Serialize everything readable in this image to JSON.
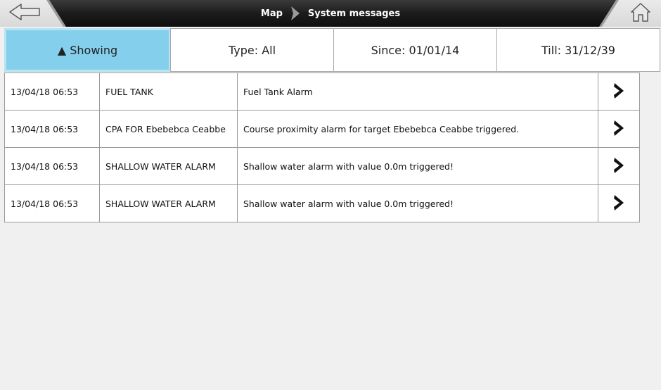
{
  "header": {
    "back_icon": "back-arrow-icon",
    "home_icon": "home-icon",
    "breadcrumb": [
      "Map",
      "System messages"
    ],
    "separator_icon": "chevron-right-icon"
  },
  "filters": {
    "showing": "▲ Showing",
    "type": "Type: All",
    "since": "Since: 01/01/14",
    "till": "Till: 31/12/39"
  },
  "messages": [
    {
      "datetime": "13/04/18 06:53",
      "type": "FUEL TANK",
      "text": "Fuel Tank Alarm"
    },
    {
      "datetime": "13/04/18 06:53",
      "type": "CPA FOR Ebebebca Ceabbe",
      "text": "Course proximity alarm for target Ebebebca Ceabbe triggered."
    },
    {
      "datetime": "13/04/18 06:53",
      "type": "SHALLOW WATER ALARM",
      "text": "Shallow water alarm with value 0.0m triggered!"
    },
    {
      "datetime": "13/04/18 06:53",
      "type": "SHALLOW WATER ALARM",
      "text": "Shallow water alarm with value 0.0m triggered!"
    }
  ],
  "colors": {
    "active_filter": "#84cfeb",
    "topbar": "#1c1c1c",
    "background": "#f0f0f0"
  }
}
